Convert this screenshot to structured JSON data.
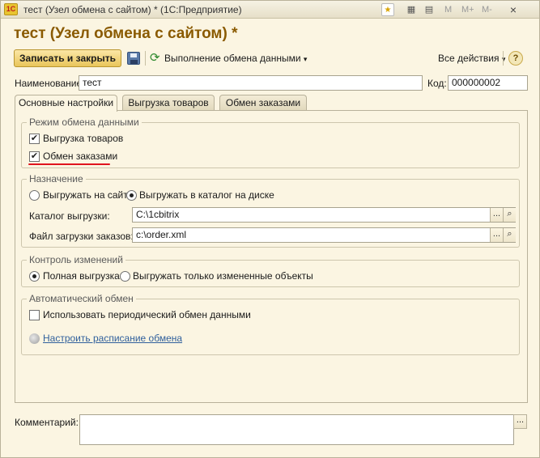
{
  "window": {
    "app_logo": "1С",
    "title": "тест (Узел обмена с сайтом) * (1С:Предприятие)",
    "favorite_icon": "star-icon",
    "title_buttons": [
      "M",
      "M+",
      "M-"
    ],
    "close": "×"
  },
  "form": {
    "title": "тест (Узел обмена с сайтом) *"
  },
  "toolbar": {
    "save_close_label": "Записать и закрыть",
    "exchange_label": "Выполнение обмена данными",
    "all_actions_label": "Все действия",
    "dropdown_arrow": "▾",
    "help_label": "?"
  },
  "fields": {
    "name_label": "Наименование:",
    "name_value": "тест",
    "code_label": "Код:",
    "code_value": "000000002"
  },
  "tabs": [
    {
      "label": "Основные настройки",
      "active": true
    },
    {
      "label": "Выгрузка товаров",
      "active": false
    },
    {
      "label": "Обмен заказами",
      "active": false
    }
  ],
  "groups": {
    "exchange_mode": {
      "title": "Режим обмена данными",
      "goods_export_label": "Выгрузка товаров",
      "goods_export_checked": true,
      "orders_exchange_label": "Обмен заказами",
      "orders_exchange_checked": true
    },
    "destination": {
      "title": "Назначение",
      "radio_site_label": "Выгружать на сайт",
      "radio_disk_label": "Выгружать в каталог на диске",
      "selected": "disk",
      "export_dir_label": "Каталог выгрузки:",
      "export_dir_value": "C:\\1cbitrix",
      "orders_file_label": "Файл загрузки заказов:",
      "orders_file_value": "c:\\order.xml",
      "pick_label": "...",
      "search_icon": "magnifier-icon"
    },
    "change_control": {
      "title": "Контроль изменений",
      "radio_full_label": "Полная выгрузка",
      "radio_changed_label": "Выгружать только измененные объекты",
      "selected": "full"
    },
    "auto_exchange": {
      "title": "Автоматический обмен",
      "periodic_label": "Использовать периодический обмен данными",
      "periodic_checked": false,
      "schedule_link": "Настроить расписание обмена"
    }
  },
  "comment": {
    "label": "Комментарий:",
    "value": "",
    "pick_label": "..."
  },
  "colors": {
    "background": "#fbf5e2",
    "title": "#8a5a00",
    "highlight": "#e0141e",
    "link": "#2f5f9c"
  }
}
